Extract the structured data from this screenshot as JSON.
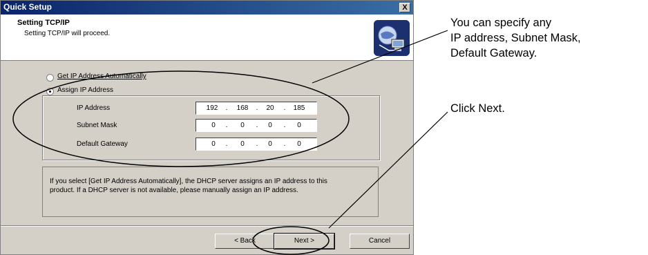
{
  "window": {
    "title": "Quick Setup",
    "close_label": "X"
  },
  "header": {
    "title": "Setting TCP/IP",
    "subtitle": "Setting TCP/IP will proceed."
  },
  "options": {
    "auto_label": "Get IP Address Automatically",
    "assign_label": "Assign IP Address",
    "selected": "assign"
  },
  "fields": [
    {
      "label": "IP Address",
      "octets": [
        "192",
        "168",
        "20",
        "185"
      ]
    },
    {
      "label": "Subnet Mask",
      "octets": [
        "0",
        "0",
        "0",
        "0"
      ]
    },
    {
      "label": "Default Gateway",
      "octets": [
        "0",
        "0",
        "0",
        "0"
      ]
    }
  ],
  "info": {
    "line1": "If you select [Get IP Address Automatically], the DHCP server assigns an IP address to this",
    "line2": "product. If a DHCP server is not available, please manually assign an IP address."
  },
  "buttons": {
    "back": "< Back",
    "next": "Next >",
    "cancel": "Cancel"
  },
  "annotations": {
    "a1_line1": "You can specify any",
    "a1_line2": "IP address, Subnet Mask,",
    "a1_line3": "Default Gateway.",
    "a2": "Click Next."
  }
}
